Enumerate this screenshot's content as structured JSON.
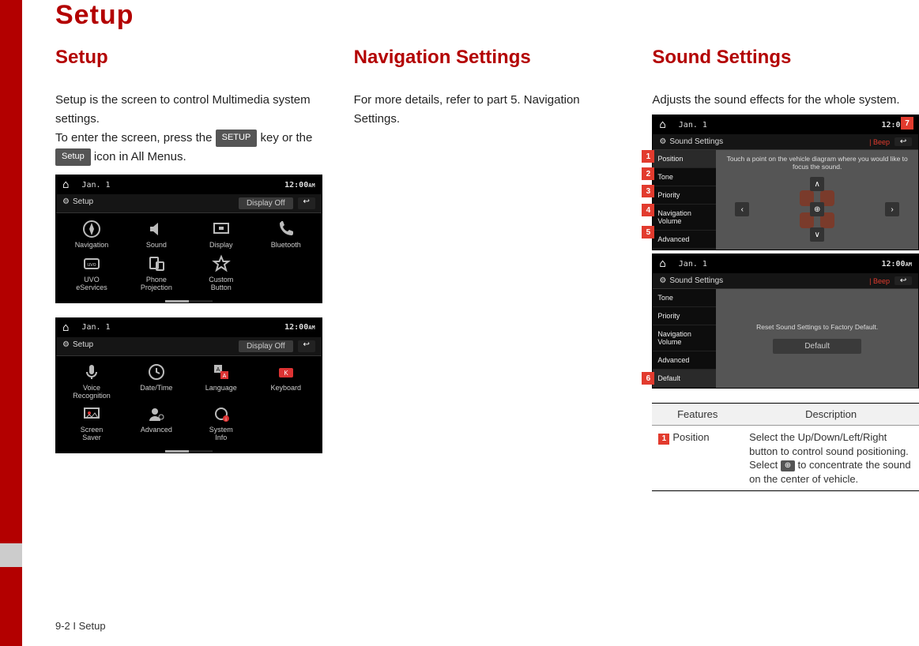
{
  "page_title": "Setup",
  "footer": "9-2 I Setup",
  "columns": {
    "setup": {
      "heading": "Setup",
      "p1": "Setup is the screen to control Multimedia system settings.",
      "p2a": "To enter the screen, press the ",
      "key_setup_hard": "SETUP",
      "p2b": " key or the ",
      "key_setup_soft": "Setup",
      "p2c": " icon in All Menus."
    },
    "nav": {
      "heading": "Navigation Settings",
      "p1": "For more details, refer to part 5. Navigation Settings."
    },
    "sound": {
      "heading": "Sound Settings",
      "p1": "Adjusts the sound effects for the whole system."
    }
  },
  "screen_common": {
    "date": "Jan. 1",
    "time": "12:00",
    "ampm": "AM",
    "setup_label": "Setup",
    "display_off": "Display Off",
    "sound_settings_label": "Sound Settings",
    "beep": "Beep"
  },
  "setup_screen1_items": [
    {
      "label": "Navigation",
      "icon": "compass"
    },
    {
      "label": "Sound",
      "icon": "speaker"
    },
    {
      "label": "Display",
      "icon": "display"
    },
    {
      "label": "Bluetooth",
      "icon": "phone"
    },
    {
      "label": "UVO eServices",
      "icon": "uvo"
    },
    {
      "label": "Phone Projection",
      "icon": "phone-proj"
    },
    {
      "label": "Custom Button",
      "icon": "star"
    }
  ],
  "setup_screen2_items": [
    {
      "label": "Voice Recognition",
      "icon": "mic"
    },
    {
      "label": "Date/Time",
      "icon": "clock"
    },
    {
      "label": "Language",
      "icon": "lang"
    },
    {
      "label": "Keyboard",
      "icon": "keyboard"
    },
    {
      "label": "Screen Saver",
      "icon": "screensaver"
    },
    {
      "label": "Advanced",
      "icon": "user-gear"
    },
    {
      "label": "System Info",
      "icon": "gear-info"
    }
  ],
  "sound_screen1": {
    "menu": [
      "Position",
      "Tone",
      "Priority",
      "Navigation Volume",
      "Advanced"
    ],
    "hint": "Touch a point on the vehicle diagram where you would like to focus the sound.",
    "callouts": {
      "1": "1",
      "2": "2",
      "3": "3",
      "4": "4",
      "5": "5",
      "7": "7"
    }
  },
  "sound_screen2": {
    "menu": [
      "Tone",
      "Priority",
      "Navigation Volume",
      "Advanced",
      "Default"
    ],
    "body_text": "Reset Sound Settings to Factory Default.",
    "default_btn": "Default",
    "callouts": {
      "6": "6"
    }
  },
  "table": {
    "h1": "Features",
    "h2": "Description",
    "row1_feature": "Position",
    "row1_desc_a": "Select the Up/Down/Left/Right button to control sound positioning.",
    "row1_desc_b": "Select ",
    "row1_desc_c": " to concentrate the sound on the center of vehicle."
  }
}
